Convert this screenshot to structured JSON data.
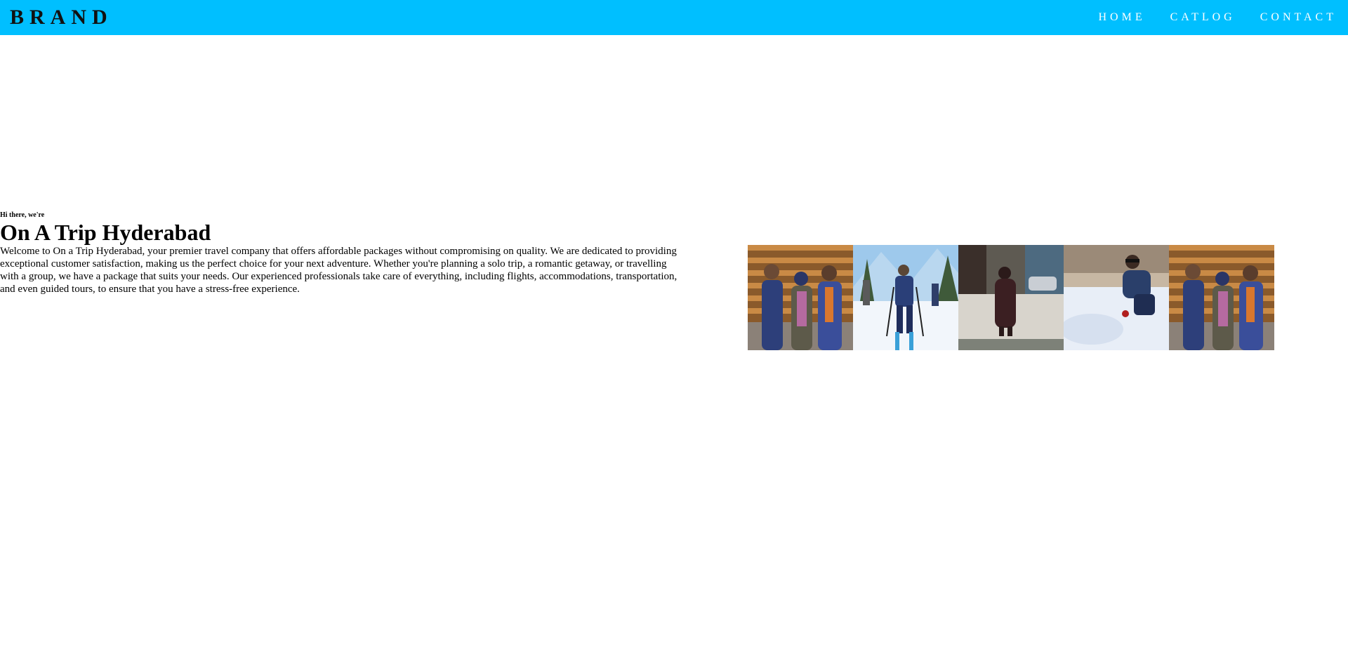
{
  "navbar": {
    "brand": "BRAND",
    "background": "#00bfff",
    "items": [
      {
        "label": "HOME"
      },
      {
        "label": "CATLOG"
      },
      {
        "label": "CONTACT"
      }
    ]
  },
  "intro": {
    "eyebrow": "Hi there, we're",
    "title": "On A Trip Hyderabad",
    "description": "Welcome to On a Trip Hyderabad, your premier travel company that offers affordable packages without compromising on quality. We are dedicated to providing exceptional customer satisfaction, making us the perfect choice for your next adventure. Whether you're planning a solo trip, a romantic getaway, or travelling with a group, we have a package that suits your needs. Our experienced professionals take care of everything, including flights, accommodations, transportation, and even guided tours, to ensure that you have a stress-free experience."
  },
  "gallery": {
    "photos": [
      {
        "name": "group-photo"
      },
      {
        "name": "skiing-photo"
      },
      {
        "name": "snowy-street-photo"
      },
      {
        "name": "snow-play-photo"
      },
      {
        "name": "group-photo"
      }
    ]
  }
}
